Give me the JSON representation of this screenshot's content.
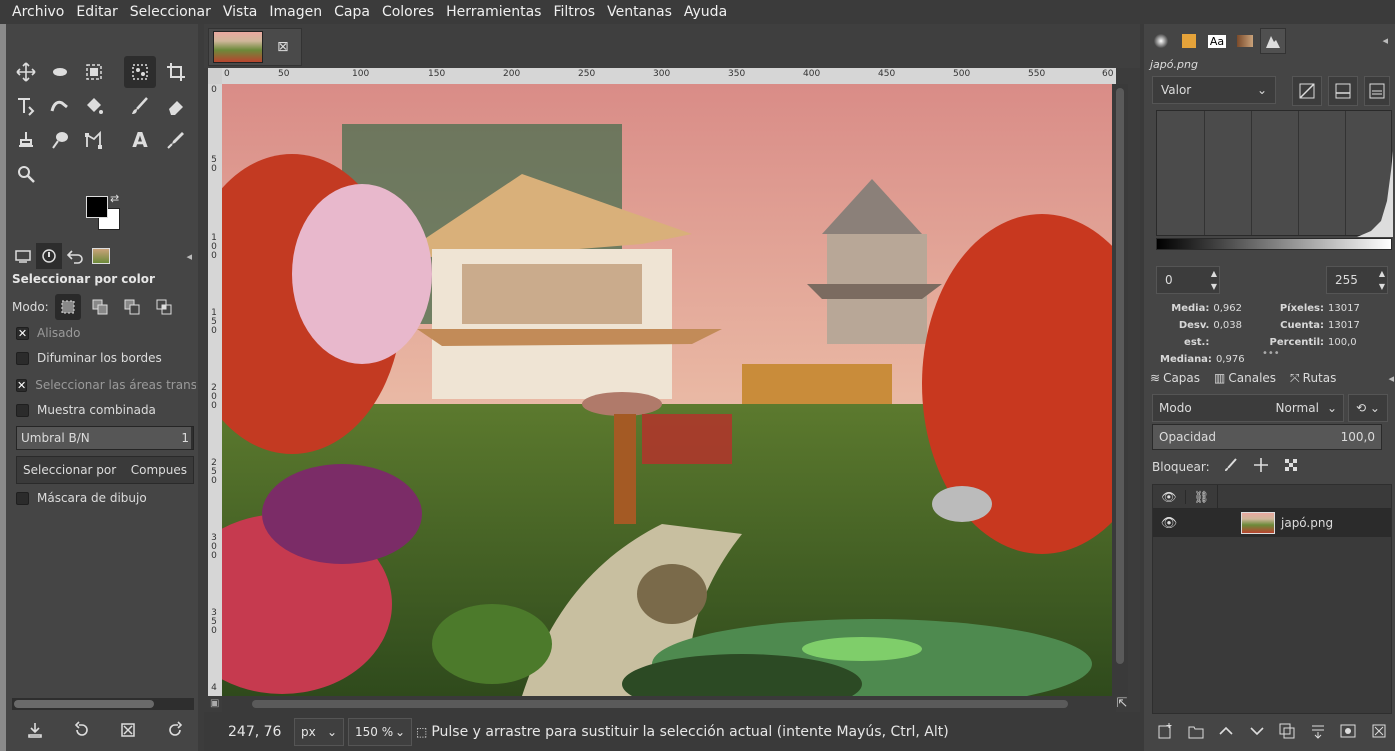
{
  "menubar": {
    "items": [
      "Archivo",
      "Editar",
      "Seleccionar",
      "Vista",
      "Imagen",
      "Capa",
      "Colores",
      "Herramientas",
      "Filtros",
      "Ventanas",
      "Ayuda"
    ]
  },
  "toolbox": {
    "tools": [
      {
        "name": "move-tool-icon"
      },
      {
        "name": "rect-select-tool-icon"
      },
      {
        "name": "warp-tool-icon"
      },
      {
        "name": "select-by-color-tool-icon"
      },
      {
        "name": "crop-tool-icon"
      },
      {
        "name": "unified-transform-tool-icon"
      },
      {
        "name": "warp-transform-tool-icon"
      },
      {
        "name": "bucket-fill-tool-icon"
      },
      {
        "name": "paintbrush-tool-icon"
      },
      {
        "name": "eraser-tool-icon"
      },
      {
        "name": "clone-tool-icon"
      },
      {
        "name": "smudge-tool-icon"
      },
      {
        "name": "paths-tool-icon"
      },
      {
        "name": "text-tool-icon"
      },
      {
        "name": "color-picker-tool-icon"
      },
      {
        "name": "zoom-tool-icon"
      }
    ],
    "fg_color": "#000000",
    "bg_color": "#ffffff"
  },
  "tool_options": {
    "title": "Seleccionar por color",
    "mode_label": "Modo:",
    "antialias": "Alisado",
    "feather": "Difuminar los bordes",
    "select_transparent": "Seleccionar las áreas transpa",
    "sample_merged": "Muestra combinada",
    "threshold_label": "Umbral B/N",
    "threshold_value": "1",
    "select_by_label": "Seleccionar por",
    "select_by_value": "Compues",
    "draw_mask": "Máscara de dibujo"
  },
  "image_window": {
    "ruler_top": [
      "0",
      "50",
      "100",
      "150",
      "200",
      "250",
      "300",
      "350",
      "400",
      "450",
      "500",
      "550",
      "60"
    ],
    "ruler_left": [
      "0",
      "5\n0",
      "1\n0\n0",
      "1\n5\n0",
      "2\n0\n0",
      "2\n5\n0",
      "3\n0\n0",
      "3\n5\n0",
      "4\n0\n0",
      "4"
    ],
    "status": {
      "position": "247, 76",
      "unit": "px",
      "zoom": "150 %",
      "message": "Pulse y arrastre para sustituir la selección actual (intente Mayús, Ctrl, Alt)"
    }
  },
  "histogram": {
    "filename": "japó.png",
    "channel": "Valor",
    "range_low": "0",
    "range_high": "255",
    "stats": {
      "mean_label": "Media:",
      "mean": "0,962",
      "stddev_label": "Desv. est.:",
      "stddev": "0,038",
      "median_label": "Mediana:",
      "median": "0,976",
      "pixels_label": "Píxeles:",
      "pixels": "13017",
      "count_label": "Cuenta:",
      "count": "13017",
      "percentile_label": "Percentil:",
      "percentile": "100,0"
    }
  },
  "layers": {
    "tabs": [
      "Capas",
      "Canales",
      "Rutas"
    ],
    "mode_label": "Modo",
    "mode_value": "Normal",
    "opacity_label": "Opacidad",
    "opacity_value": "100,0",
    "lock_label": "Bloquear:",
    "layer_name": "japó.png"
  },
  "colors": {
    "accent": "#4a90d9"
  }
}
